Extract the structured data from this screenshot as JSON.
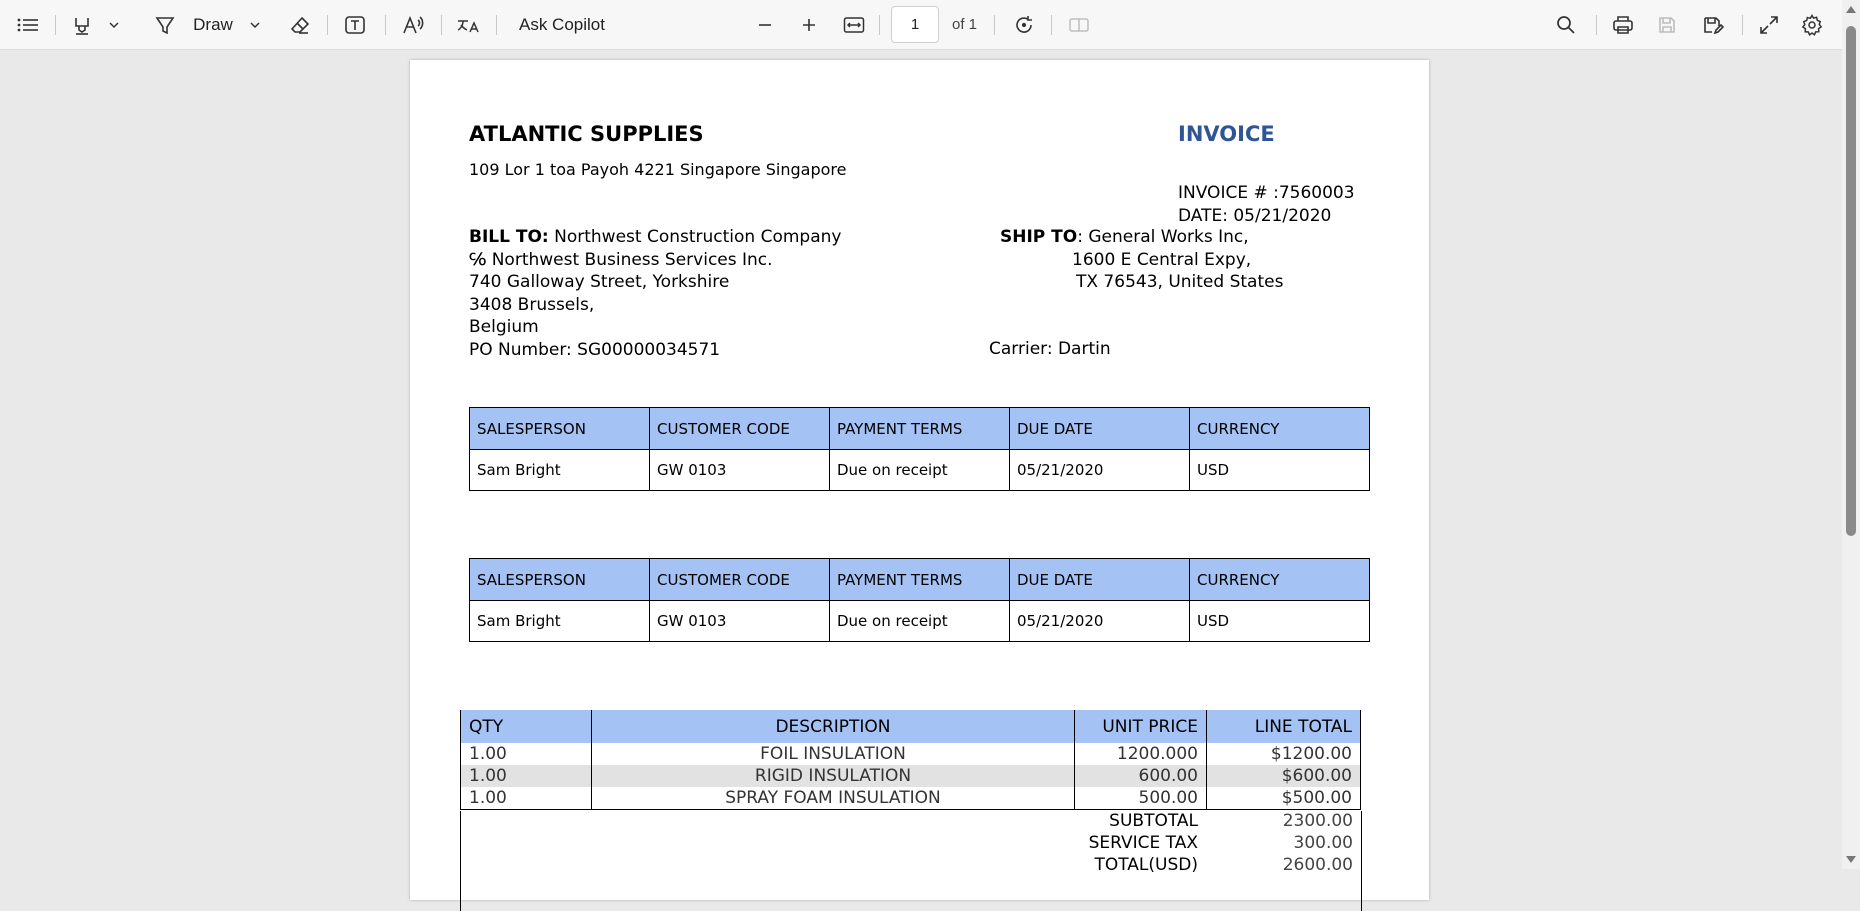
{
  "toolbar": {
    "draw_label": "Draw",
    "ask_copilot_label": "Ask Copilot",
    "page_number": "1",
    "page_of": "of 1"
  },
  "invoice": {
    "company": "ATLANTIC SUPPLIES",
    "company_address": "109 Lor 1 toa Payoh 4221 Singapore Singapore",
    "title": "INVOICE",
    "invoice_number": "INVOICE # :7560003",
    "date": "DATE: 05/21/2020",
    "bill_to": {
      "label": "BILL TO:",
      "name": " Northwest Construction Company",
      "line2": "℅ Northwest Business Services Inc.",
      "line3": "740 Galloway Street, Yorkshire",
      "line4": "3408 Brussels,",
      "line5": "Belgium",
      "po": "PO Number: SG00000034571"
    },
    "ship_to": {
      "label": "SHIP TO",
      "name": ": General Works Inc,",
      "line2": "1600 E Central Expy,",
      "line3": "TX 76543, United States",
      "carrier": "Carrier: Dartin"
    },
    "info_headers": [
      "SALESPERSON",
      "CUSTOMER CODE",
      "PAYMENT TERMS",
      "DUE DATE",
      "CURRENCY"
    ],
    "info_row": [
      "Sam Bright",
      "GW 0103",
      "Due on receipt",
      "05/21/2020",
      "USD"
    ],
    "items_headers": [
      "QTY",
      "DESCRIPTION",
      "UNIT PRICE",
      "LINE TOTAL"
    ],
    "items": [
      [
        "1.00",
        "FOIL INSULATION",
        "1200.000",
        "$1200.00"
      ],
      [
        "1.00",
        "RIGID INSULATION",
        "600.00",
        "$600.00"
      ],
      [
        "1.00",
        "SPRAY FOAM INSULATION",
        "500.00",
        "$500.00"
      ]
    ],
    "totals": {
      "subtotal_label": "SUBTOTAL",
      "subtotal": "2300.00",
      "tax_label": "SERVICE TAX",
      "tax": "300.00",
      "total_label": "TOTAL(USD)",
      "total": "2600.00"
    }
  },
  "colors": {
    "header_fill": "#a4c2f4",
    "invoice_title": "#2f5597",
    "row_shade": "#e2e2e2"
  }
}
